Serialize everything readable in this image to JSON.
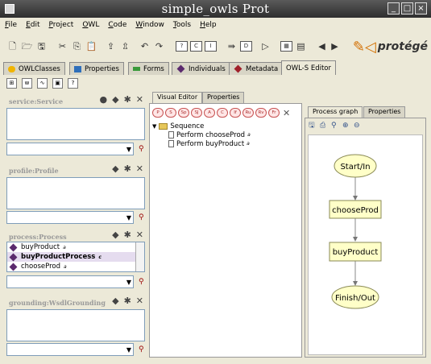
{
  "window": {
    "title": "simple_owls Prot"
  },
  "menu": [
    "File",
    "Edit",
    "Project",
    "OWL",
    "Code",
    "Window",
    "Tools",
    "Help"
  ],
  "logo": {
    "text": "protégé"
  },
  "tabs": [
    {
      "label": "OWLClasses",
      "color": "#f0b400"
    },
    {
      "label": "Properties",
      "color": "#2f6fba"
    },
    {
      "label": "Forms",
      "color": "#3a9a3a"
    },
    {
      "label": "Individuals",
      "color": "#6b2a72"
    },
    {
      "label": "Metadata",
      "color": "#a0202a"
    },
    {
      "label": "OWL-S Editor",
      "color": ""
    }
  ],
  "left": {
    "service_label": "service:Service",
    "profile_label": "profile:Profile",
    "process_label": "process:Process",
    "grounding_label": "grounding:WsdlGrounding",
    "process_items": [
      {
        "label": "buyProduct",
        "sup": "a"
      },
      {
        "label": "buyProductProcess",
        "sup": "c"
      },
      {
        "label": "chooseProd",
        "sup": "a"
      }
    ]
  },
  "middle": {
    "tab_visual": "Visual Editor",
    "tab_properties": "Properties",
    "controls": [
      "P",
      "S",
      "Sp",
      "SJ",
      "A",
      "C",
      "If",
      "Ru",
      "Rv",
      "Fr"
    ],
    "tree": {
      "root": "Sequence",
      "children": [
        "Perform chooseProd",
        "Perform buyProduct"
      ],
      "child_sup": "a"
    }
  },
  "right": {
    "tab_graph": "Process graph",
    "tab_properties": "Properties",
    "nodes": {
      "start": "Start/In",
      "a": "chooseProd",
      "b": "buyProduct",
      "finish": "Finish/Out"
    },
    "colors": {
      "node": "#ffffc8",
      "node_border": "#8a8a55"
    }
  }
}
